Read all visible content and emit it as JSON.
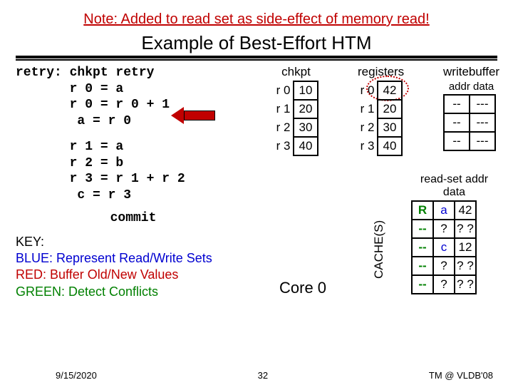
{
  "note": "Note: Added to read set as side-effect of memory read!",
  "title": "Example of Best-Effort HTM",
  "code_block1": "retry: chkpt retry\n       r 0 = a\n       r 0 = r 0 + 1\n        a = r 0",
  "code_block2": "       r 1 = a\n       r 2 = b\n       r 3 = r 1 + r 2\n        c = r 3",
  "commit": "commit",
  "key": {
    "title": "KEY:",
    "blue": "BLUE: Represent Read/Write Sets",
    "red": "RED: Buffer Old/New Values",
    "green": "GREEN: Detect Conflicts"
  },
  "tables": {
    "chkpt": {
      "header": "chkpt",
      "rows": [
        {
          "label": "r 0",
          "val": "10"
        },
        {
          "label": "r 1",
          "val": "20"
        },
        {
          "label": "r 2",
          "val": "30"
        },
        {
          "label": "r 3",
          "val": "40"
        }
      ]
    },
    "registers": {
      "header": "registers",
      "rows": [
        {
          "label": "r 0",
          "val": "42"
        },
        {
          "label": "r 1",
          "val": "20"
        },
        {
          "label": "r 2",
          "val": "30"
        },
        {
          "label": "r 3",
          "val": "40"
        }
      ]
    },
    "writebuffer": {
      "header": "writebuffer",
      "sub": "addr data",
      "rows": [
        {
          "a": "--",
          "b": "---"
        },
        {
          "a": "--",
          "b": "---"
        },
        {
          "a": "--",
          "b": "---"
        }
      ]
    },
    "readset": {
      "header": "read-set addr data",
      "rows": [
        {
          "s": "R",
          "a": "a",
          "d": "42"
        },
        {
          "s": "--",
          "a": "?",
          "d": "? ?"
        },
        {
          "s": "--",
          "a": "c",
          "d": "12"
        },
        {
          "s": "--",
          "a": "?",
          "d": "? ?"
        },
        {
          "s": "--",
          "a": "?",
          "d": "? ?"
        }
      ]
    }
  },
  "cache_label": "CACHE(S)",
  "core_label": "Core 0",
  "footer": {
    "date": "9/15/2020",
    "page": "32",
    "venue": "TM @ VLDB'08"
  }
}
